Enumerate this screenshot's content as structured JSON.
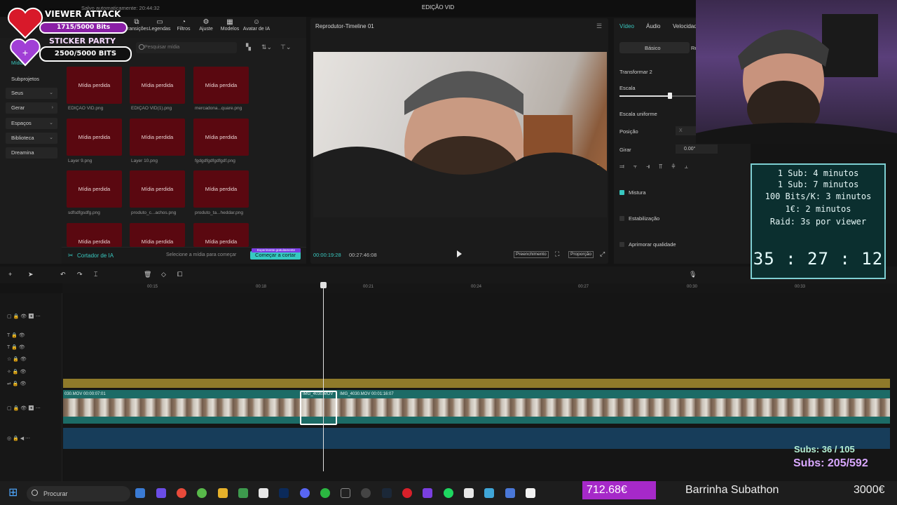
{
  "app": {
    "title": "EDIÇÃO VID",
    "menu_label": "Menu",
    "save_status": "Salvo automaticamente: 20:44:32"
  },
  "media_tabs": [
    "Transições",
    "Legendas",
    "Filtros",
    "Ajuste",
    "Modelos",
    "Avatar de IA"
  ],
  "media": {
    "tab_label": "Mídia",
    "search_placeholder": "Pesquisar mídia",
    "nav": [
      "Subprojetos",
      "Seus",
      "Gerar",
      "Espaços",
      "Biblioteca",
      "Dreamina"
    ],
    "thumb_text": "Mídia perdida",
    "captions": [
      "EDIÇÃO VID.png",
      "EDIÇÃO VID(1).png",
      "mercadona...quare.png",
      "Layer 9.png",
      "Layer 10.png",
      "fgdgdfgdfgdfgdf.png",
      "sdfsdfgsdfg.png",
      "produto_c...achos.png",
      "produto_ta...heddar.png",
      "",
      "",
      ""
    ],
    "ai_cutter": "Cortador de IA",
    "ai_hint": "Selecione a mídia para começar",
    "start_cut": "Começar a cortar",
    "try_free": "Experimente gratuitamente"
  },
  "player": {
    "title": "Reprodutor-Timeline 01",
    "tc_current": "00:00:19:28",
    "tc_total": "00:27:46:08",
    "fill_label": "Preenchimento",
    "ratio_label": "Proporção"
  },
  "props": {
    "tabs": [
      "Vídeo",
      "Áudio",
      "Velocidade"
    ],
    "subtab": "Básico",
    "subtab2": "Re",
    "transform": "Transformar 2",
    "scale": "Escala",
    "uniform_scale": "Escala uniforme",
    "position": "Posição",
    "rotate": "Girar",
    "rotate_value": "0.00°",
    "blend": "Mistura",
    "stabilize": "Estabilização",
    "enhance": "Aprimorar qualidade",
    "pos_x": "X"
  },
  "overlay": {
    "viewer_attack": "VIEWER ATTACK",
    "bits1": "1715/5000 Bits",
    "sticker_party": "STICKER PARTY",
    "bits2": "2500/5000 BITS",
    "alerts": [
      "1 Sub: 4 minutos",
      "1 Sub: 7 minutos",
      "100 Bits/K: 3 minutos",
      "1€: 2 minutos",
      "Raid: 3s por viewer"
    ],
    "timer": "35 : 27 : 12",
    "subs_a": "Subs: 36 / 105",
    "subs_b": "Subs: 205/592",
    "money": "712.68€",
    "bar_label": "Barrinha Subathon",
    "goal": "3000€"
  },
  "timeline": {
    "ticks": [
      "00:15",
      "00:18",
      "00:21",
      "00:24",
      "00:27",
      "00:30",
      "00:33"
    ],
    "clips": [
      {
        "label": "030.MOV  00:00:07:01"
      },
      {
        "label": "IMG_4030.MOV"
      },
      {
        "label": "IMG_4030.MOV  00:01:16:07"
      }
    ]
  },
  "taskbar": {
    "search": "Procurar"
  },
  "colors": {
    "accent": "#38c8c0",
    "lost_media": "#5a0810",
    "overlay_purple": "#a629c9"
  }
}
